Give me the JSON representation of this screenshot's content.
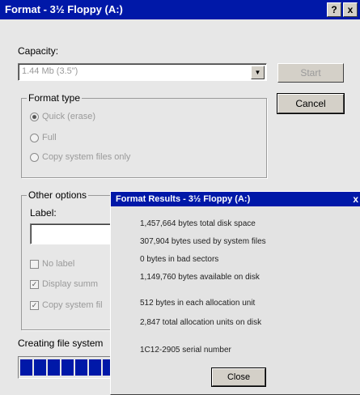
{
  "window": {
    "title": "Format - 3½ Floppy (A:)",
    "help_label": "?",
    "close_label": "x"
  },
  "capacity": {
    "label": "Capacity:",
    "value": "1.44 Mb (3.5\")"
  },
  "buttons": {
    "start": "Start",
    "cancel": "Cancel"
  },
  "format_type": {
    "legend": "Format type",
    "options": [
      {
        "label": "Quick (erase)",
        "selected": true
      },
      {
        "label": "Full",
        "selected": false
      },
      {
        "label": "Copy system files only",
        "selected": false
      }
    ]
  },
  "other_options": {
    "legend": "Other options",
    "label_caption": "Label:",
    "label_value": "",
    "checkboxes": [
      {
        "label": "No label",
        "checked": false
      },
      {
        "label": "Display summ",
        "checked": true
      },
      {
        "label": "Copy system fil",
        "checked": true
      }
    ]
  },
  "status": {
    "text": "Creating file system",
    "progress": 0.9
  },
  "results": {
    "title": "Format Results - 3½ Floppy (A:)",
    "close_label": "x",
    "lines": [
      "1,457,664 bytes total disk space",
      "307,904 bytes used by system files",
      "0 bytes in bad sectors",
      "1,149,760 bytes available on disk",
      "512 bytes in each allocation unit",
      "2,847 total allocation units on disk",
      "1C12-2905 serial number"
    ],
    "close_button": "Close"
  }
}
